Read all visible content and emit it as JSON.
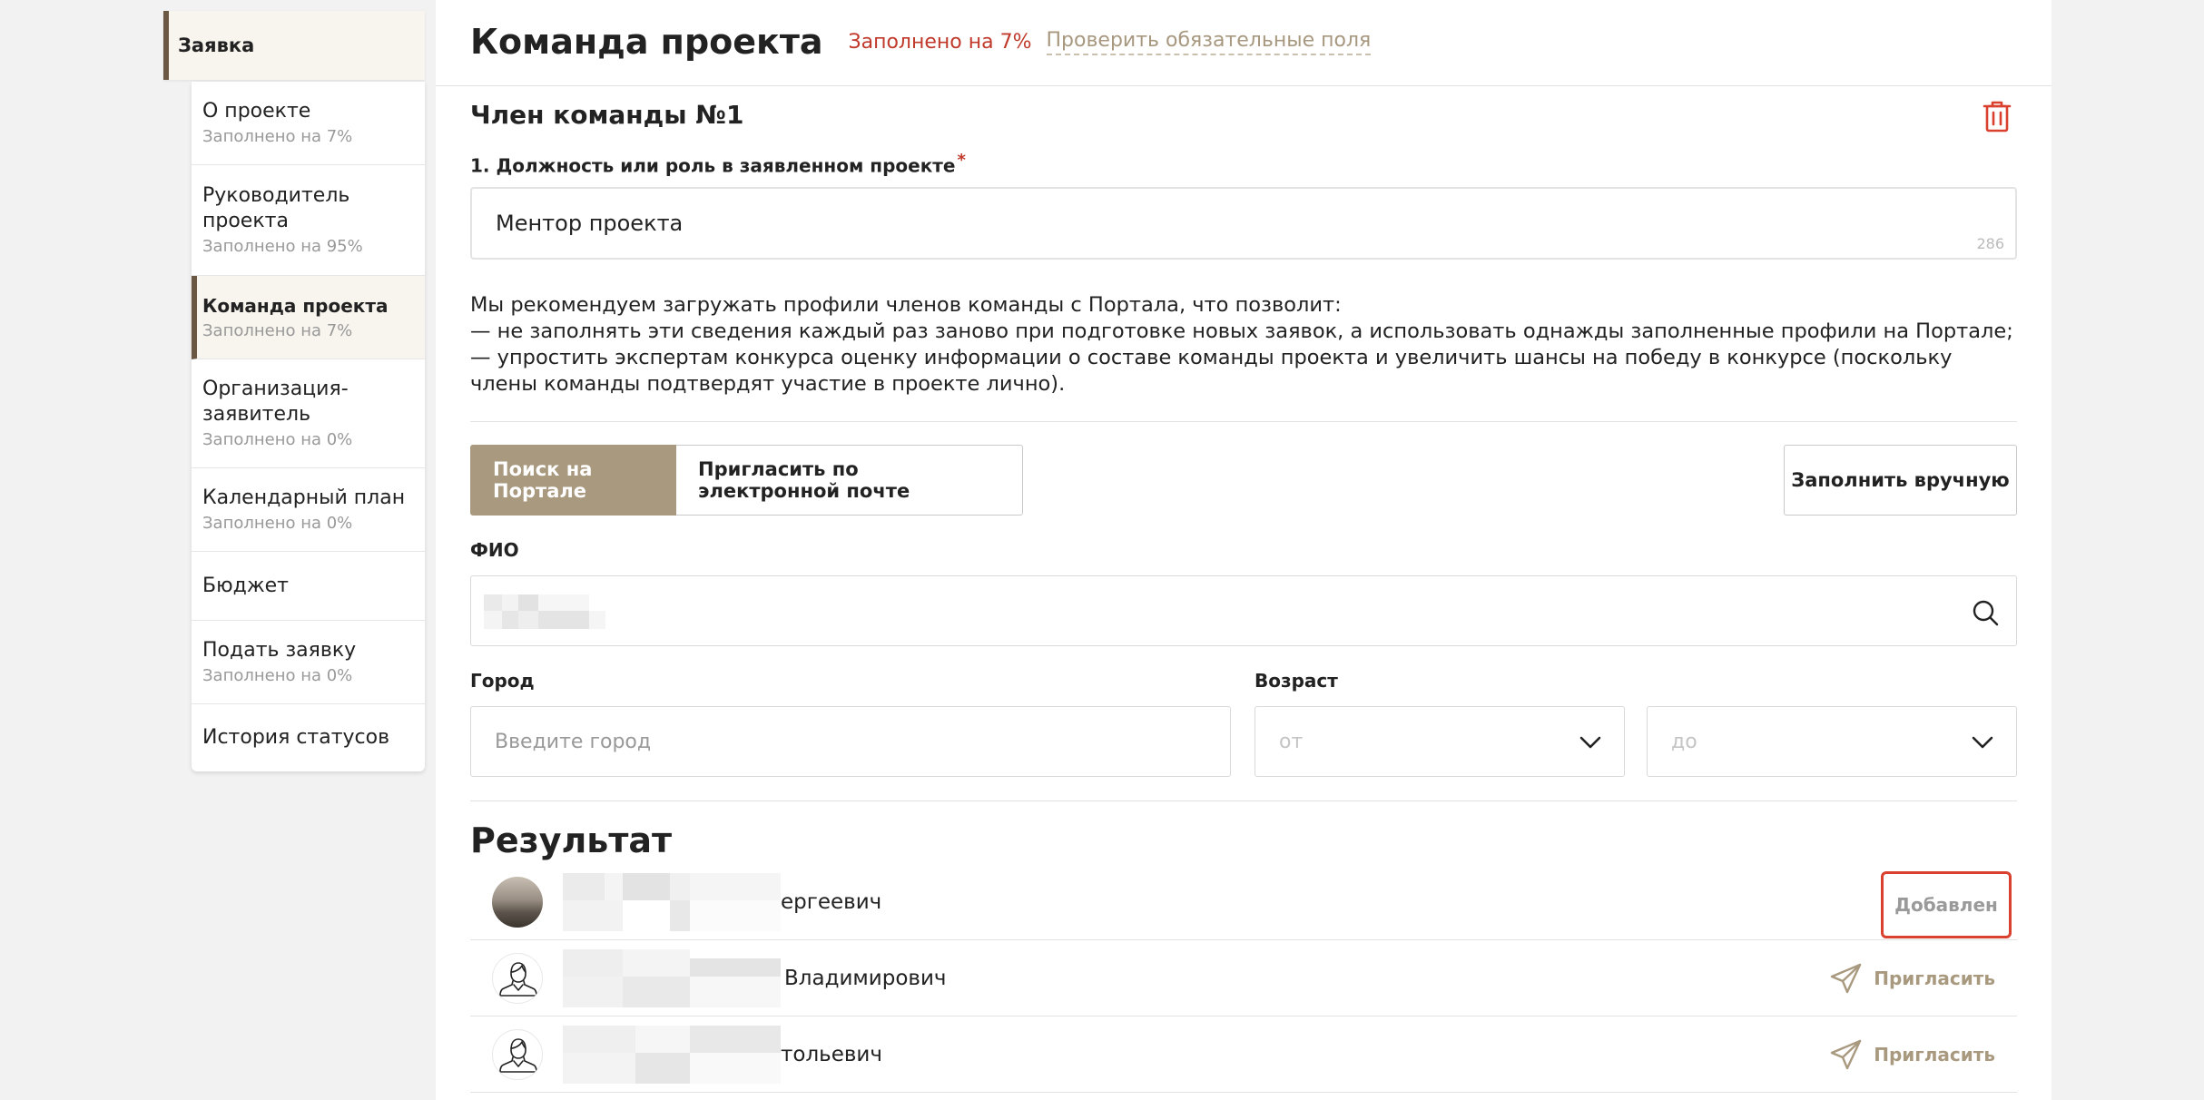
{
  "sidebar": {
    "root_label": "Заявка",
    "items": [
      {
        "title": "О проекте",
        "subtitle": "Заполнено на 7%"
      },
      {
        "title": "Руководитель проекта",
        "subtitle": "Заполнено на 95%"
      },
      {
        "title": "Команда проекта",
        "subtitle": "Заполнено на 7%"
      },
      {
        "title": "Организация-заявитель",
        "subtitle": "Заполнено на 0%"
      },
      {
        "title": "Календарный план",
        "subtitle": "Заполнено на 0%"
      },
      {
        "title": "Бюджет",
        "subtitle": ""
      },
      {
        "title": "Подать заявку",
        "subtitle": "Заполнено на 0%"
      },
      {
        "title": "История статусов",
        "subtitle": ""
      }
    ]
  },
  "header": {
    "title": "Команда проекта",
    "progress": "Заполнено на 7%",
    "check_link": "Проверить обязательные поля"
  },
  "member": {
    "title": "Член команды №1",
    "role_label": "1. Должность или роль в заявленном проекте",
    "required_mark": "*",
    "role_value": "Ментор проекта",
    "char_count": "286"
  },
  "info": {
    "line1": "Мы рекомендуем загружать профили членов команды с Портала, что позволит:",
    "line2": "— не заполнять эти сведения каждый раз заново при подготовке новых заявок, а использовать однажды заполненные профили на Портале;",
    "line3": "— упростить экспертам конкурса оценку информации о составе команды проекта и увеличить шансы на победу в конкурсе (поскольку члены команды подтвердят участие в проекте лично)."
  },
  "tabs": {
    "search": "Поиск на Портале",
    "invite": "Пригласить по электронной почте",
    "manual": "Заполнить вручную"
  },
  "search_form": {
    "fio_label": "ФИО",
    "city_label": "Город",
    "city_placeholder": "Введите город",
    "age_label": "Возраст",
    "age_from": "от",
    "age_to": "до"
  },
  "results": {
    "title": "Результат",
    "rows": [
      {
        "name_suffix": "ергеевич",
        "action": "Добавлен",
        "avatar": "photo",
        "status": "added"
      },
      {
        "name_suffix": "Владимирович",
        "action": "Пригласить",
        "avatar": "person-outline-icon",
        "status": "invite"
      },
      {
        "name_suffix": "тольевич",
        "action": "Пригласить",
        "avatar": "person-outline-icon",
        "status": "invite"
      }
    ]
  },
  "colors": {
    "accent": "#a8997f",
    "sidebar_active_bar": "#6b5844",
    "progress_red": "#c0392b",
    "added_border": "#d9402e"
  }
}
